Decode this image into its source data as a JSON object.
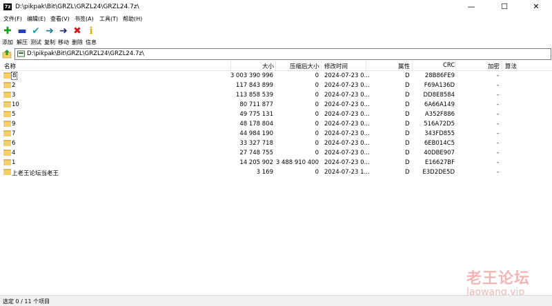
{
  "window": {
    "title": "D:\\pikpak\\Bit\\GRZL\\GRZL24\\GRZL24.7z\\",
    "app_icon_text": "7z",
    "controls": {
      "minimize": "—",
      "maximize": "☐",
      "close": "✕"
    }
  },
  "menu": [
    "文件(F)",
    "编辑(E)",
    "查看(V)",
    "书签(A)",
    "工具(T)",
    "帮助(H)"
  ],
  "toolbar": [
    {
      "label": "添加",
      "icon": "plus-icon",
      "color": "#1a9e1a"
    },
    {
      "label": "解压",
      "icon": "minus-icon",
      "color": "#1f3fbf"
    },
    {
      "label": "测试",
      "icon": "check-icon",
      "color": "#1aa7b8"
    },
    {
      "label": "复制",
      "icon": "copy-arrow-icon",
      "color": "#1a7c9e"
    },
    {
      "label": "移动",
      "icon": "move-arrow-icon",
      "color": "#1a2f7c"
    },
    {
      "label": "删除",
      "icon": "delete-x-icon",
      "color": "#d11a1a"
    },
    {
      "label": "信息",
      "icon": "info-icon",
      "color": "#d9b400"
    }
  ],
  "address": {
    "path": "D:\\pikpak\\Bit\\GRZL\\GRZL24\\GRZL24.7z\\"
  },
  "columns": {
    "name": "名称",
    "size": "大小",
    "packed": "压缩后大小",
    "modified": "修改时间",
    "attributes": "属性",
    "crc": "CRC",
    "encrypted": "加密",
    "method": "算法"
  },
  "rows": [
    {
      "name": "8",
      "size": "3 003 390 996",
      "packed": "0",
      "modified": "2024-07-23 0...",
      "attr": "D",
      "crc": "28B86FE9",
      "enc": "-"
    },
    {
      "name": "2",
      "size": "117 843 899",
      "packed": "0",
      "modified": "2024-07-23 0...",
      "attr": "D",
      "crc": "F69A136D",
      "enc": "-"
    },
    {
      "name": "3",
      "size": "113 858 539",
      "packed": "0",
      "modified": "2024-07-23 0...",
      "attr": "D",
      "crc": "DD8E8584",
      "enc": "-"
    },
    {
      "name": "10",
      "size": "80 711 877",
      "packed": "0",
      "modified": "2024-07-23 0...",
      "attr": "D",
      "crc": "6A66A149",
      "enc": "-"
    },
    {
      "name": "5",
      "size": "49 775 131",
      "packed": "0",
      "modified": "2024-07-23 0...",
      "attr": "D",
      "crc": "A352F886",
      "enc": "-"
    },
    {
      "name": "9",
      "size": "48 178 804",
      "packed": "0",
      "modified": "2024-07-23 0...",
      "attr": "D",
      "crc": "516A72D5",
      "enc": "-"
    },
    {
      "name": "7",
      "size": "44 984 190",
      "packed": "0",
      "modified": "2024-07-23 0...",
      "attr": "D",
      "crc": "343FD855",
      "enc": "-"
    },
    {
      "name": "6",
      "size": "33 327 718",
      "packed": "0",
      "modified": "2024-07-23 0...",
      "attr": "D",
      "crc": "6EB014C5",
      "enc": "-"
    },
    {
      "name": "4",
      "size": "27 748 755",
      "packed": "0",
      "modified": "2024-07-23 0...",
      "attr": "D",
      "crc": "40DBE907",
      "enc": "-"
    },
    {
      "name": "1",
      "size": "14 205 902",
      "packed": "3 488 910 400",
      "modified": "2024-07-23 0...",
      "attr": "D",
      "crc": "E16627BF",
      "enc": "-"
    },
    {
      "name": "上老王论坛当老王",
      "size": "3 169",
      "packed": "0",
      "modified": "2024-07-23 1...",
      "attr": "D",
      "crc": "E3D2DE5D",
      "enc": "-"
    }
  ],
  "status": {
    "text": "选定 0 / 11 个项目"
  },
  "watermark": {
    "title": "老王论坛",
    "url": "laowang.vip"
  }
}
